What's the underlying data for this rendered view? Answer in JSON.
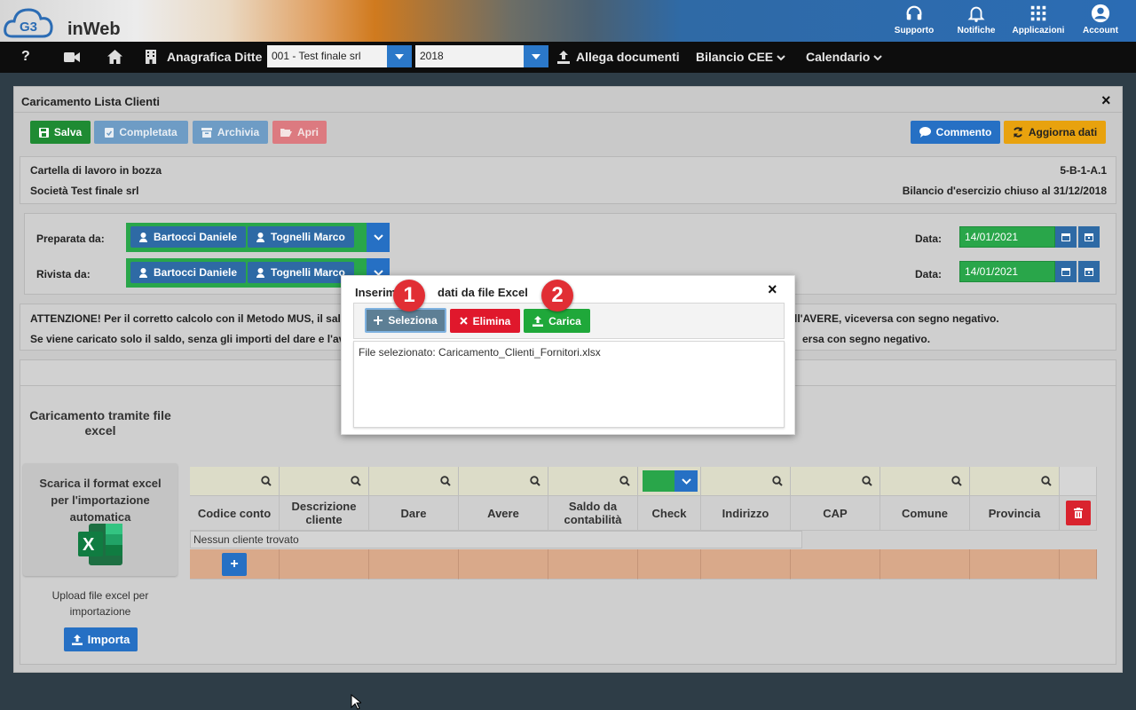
{
  "app": {
    "logo_text": "inWeb"
  },
  "topbar": {
    "items": [
      {
        "label": "Supporto",
        "icon": "headset-icon"
      },
      {
        "label": "Notifiche",
        "icon": "bell-icon"
      },
      {
        "label": "Applicazioni",
        "icon": "apps-grid-icon"
      },
      {
        "label": "Account",
        "icon": "account-icon"
      }
    ]
  },
  "navbar": {
    "help": "?",
    "company_label": "Anagrafica Ditte",
    "company_value": "001 - Test finale srl",
    "year_value": "2018",
    "attach": "Allega documenti",
    "bilancio": "Bilancio CEE",
    "calendario": "Calendario"
  },
  "panel": {
    "title": "Caricamento Lista Clienti",
    "close": "×",
    "toolbar": {
      "save": "Salva",
      "completed": "Completata",
      "archive": "Archivia",
      "open": "Apri",
      "comment": "Commento",
      "refresh": "Aggiorna dati"
    },
    "info": {
      "status": "Cartella di lavoro in bozza",
      "code": "5-B-1-A.1",
      "company": "Società Test finale srl",
      "period": "Bilancio d'esercizio chiuso al 31/12/2018"
    },
    "people": {
      "prepared_label": "Preparata da:",
      "reviewed_label": "Rivista da:",
      "person1": "Bartocci Daniele",
      "person2": "Tognelli Marco",
      "date_label": "Data:",
      "prepared_date": "14/01/2021",
      "reviewed_date": "14/01/2021"
    },
    "warning": {
      "line1_left": "ATTENZIONE! Per il corretto calcolo con il Metodo MUS, il sal",
      "line1_right": "ll'AVERE, viceversa con segno negativo.",
      "line2_left": "Se viene caricato solo il saldo, senza gli importi del dare e l'av",
      "line2_right": "ersa con segno negativo."
    },
    "upload": {
      "heading": "Caricamento tramite file excel",
      "download_box": "Scarica il format excel per l'importazione automatica",
      "upload_text": "Upload file excel per importazione",
      "import": "Importa"
    },
    "table": {
      "columns": [
        "Codice conto",
        "Descrizione cliente",
        "Dare",
        "Avere",
        "Saldo da contabilità",
        "Check",
        "Indirizzo",
        "CAP",
        "Comune",
        "Provincia"
      ],
      "empty": "Nessun cliente trovato",
      "add": "+"
    }
  },
  "modal": {
    "title_left": "Inserim",
    "title_right": "dati da file Excel",
    "close": "×",
    "select": "Seleziona",
    "delete": "Elimina",
    "upload": "Carica",
    "file_label": "File selezionato: Caricamento_Clienti_Fornitori.xlsx",
    "badge1": "1",
    "badge2": "2"
  },
  "colors": {
    "green": "#27a243",
    "blue": "#2e6aa5",
    "red": "#d9232e",
    "orange": "#e8a20e",
    "peach": "#d9a98a"
  }
}
